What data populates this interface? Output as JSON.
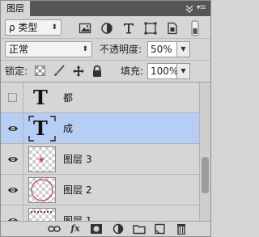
{
  "tab": {
    "label": "图层"
  },
  "filter": {
    "kind_label": "ρ 类型"
  },
  "blend": {
    "mode": "正常",
    "opacity_label": "不透明度:",
    "opacity_value": "50%"
  },
  "lock": {
    "label": "锁定:",
    "fill_label": "填充:",
    "fill_value": "100%"
  },
  "layers": [
    {
      "name": "都",
      "type": "text",
      "visible": false,
      "selected": false
    },
    {
      "name": "成",
      "type": "text",
      "visible": true,
      "selected": true
    },
    {
      "name": "图层 3",
      "type": "pixel",
      "visible": true,
      "selected": false
    },
    {
      "name": "图层 2",
      "type": "pixel",
      "visible": true,
      "selected": false
    },
    {
      "name": "图层 1",
      "type": "pixel",
      "visible": true,
      "selected": false
    }
  ],
  "colors": {
    "selected_row": "#b6cdf4",
    "panel_bg": "#d6d6d6",
    "tab_bar": "#565656"
  },
  "bottom_icons": [
    "link-icon",
    "fx-icon",
    "mask-icon",
    "adjustment-icon",
    "group-folder-icon",
    "new-layer-icon",
    "trash-icon"
  ],
  "bottom_labels": {
    "fx": "fx"
  }
}
